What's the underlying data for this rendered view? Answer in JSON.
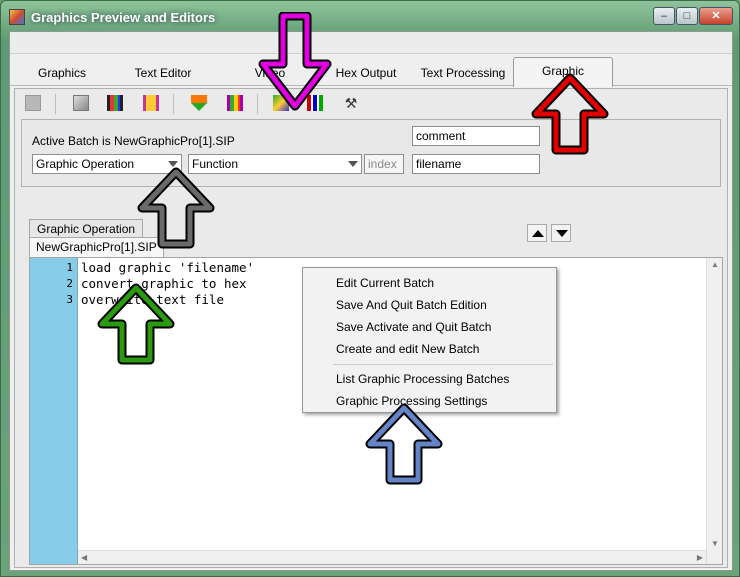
{
  "window": {
    "title": "Graphics Preview and Editors",
    "controls": {
      "minimize": "–",
      "maximize": "□",
      "close": "✕"
    }
  },
  "tabs": [
    "Graphics",
    "Text Editor",
    "Video",
    "Hex Output",
    "Text Processing",
    "Graphic Processing"
  ],
  "active_tab": "Graphic Processing",
  "toolbar": {
    "icons": [
      "disabled-block-icon",
      "stop-icon",
      "film-strip-icon",
      "film-strip-yellow-icon",
      "download-arrow-icon",
      "film-strip-purple-icon",
      "green-film-icon",
      "bars-chart-icon",
      "tools-icon"
    ]
  },
  "batch": {
    "label": "Active Batch is NewGraphicPro[1].SIP",
    "operation_select": "Graphic Operation",
    "function_select": "Function",
    "index_placeholder": "index",
    "comment_value": "comment",
    "filename_value": "filename"
  },
  "operation_header": "Graphic Operation",
  "doc_tab": "NewGraphicPro[1].SIP",
  "editor": {
    "lines": [
      {
        "n": "1",
        "text": "load graphic 'filename'"
      },
      {
        "n": "2",
        "text": "convert graphic to hex"
      },
      {
        "n": "3",
        "text": "overwrite text file"
      }
    ]
  },
  "context_menu": {
    "group1": [
      "Edit Current Batch",
      "Save And Quit Batch Edition",
      "Save Activate and Quit Batch",
      "Create and edit New Batch"
    ],
    "group2": [
      "List Graphic Processing Batches",
      "Graphic Processing Settings"
    ]
  },
  "callout_colors": {
    "magenta": "#e000e0",
    "red": "#e00000",
    "gray": "#6a6a6a",
    "green": "#2a9a10",
    "blue": "#6484c8"
  }
}
